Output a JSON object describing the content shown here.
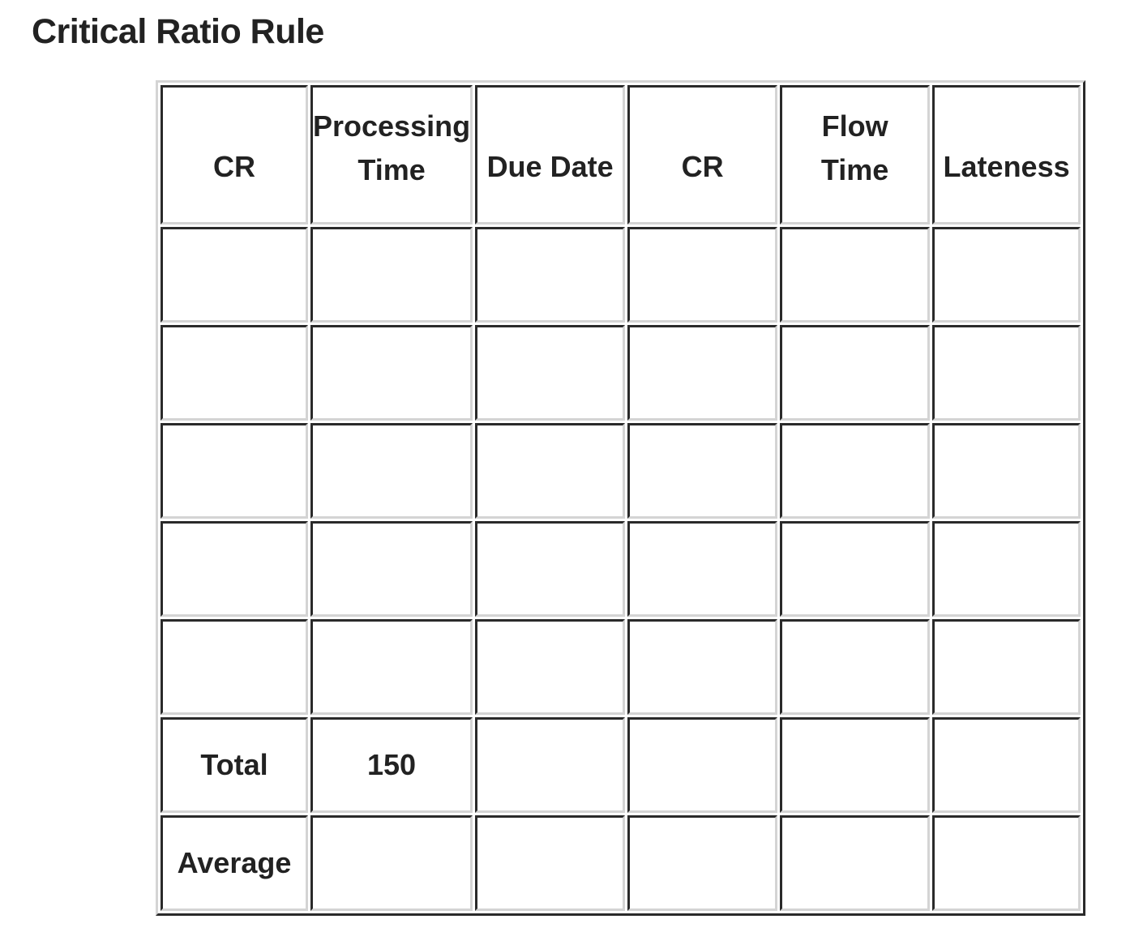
{
  "title": "Critical Ratio Rule",
  "table": {
    "headers": [
      {
        "line1": "",
        "line2": "CR"
      },
      {
        "line1": "Processing",
        "line2": "Time"
      },
      {
        "line1": "",
        "line2": "Due Date"
      },
      {
        "line1": "",
        "line2": "CR"
      },
      {
        "line1": "Flow",
        "line2": "Time"
      },
      {
        "line1": "",
        "line2": "Lateness"
      }
    ],
    "rows": [
      [
        "",
        "",
        "",
        "",
        "",
        ""
      ],
      [
        "",
        "",
        "",
        "",
        "",
        ""
      ],
      [
        "",
        "",
        "",
        "",
        "",
        ""
      ],
      [
        "",
        "",
        "",
        "",
        "",
        ""
      ],
      [
        "",
        "",
        "",
        "",
        "",
        ""
      ],
      [
        "Total",
        "150",
        "",
        "",
        "",
        ""
      ],
      [
        "Average",
        "",
        "",
        "",
        "",
        ""
      ]
    ]
  }
}
